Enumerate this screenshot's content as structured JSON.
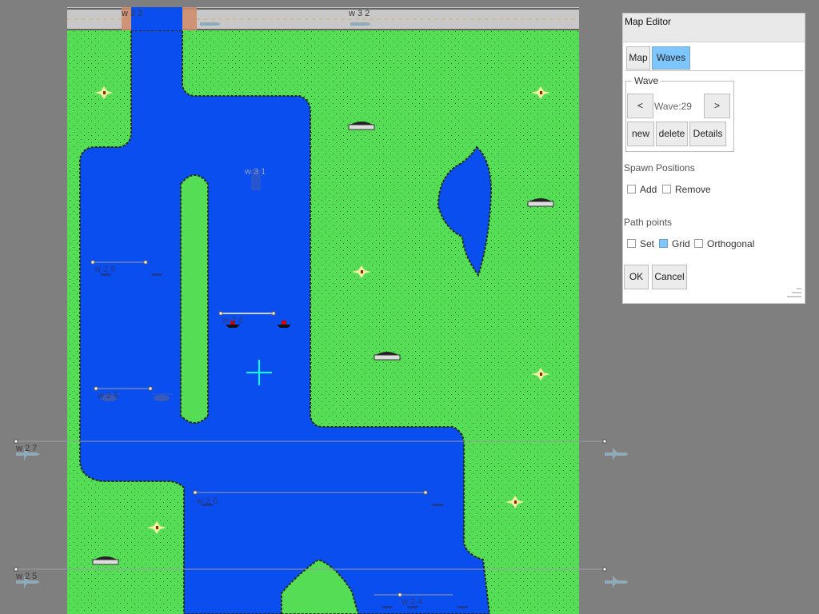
{
  "editor": {
    "title": "Map Editor",
    "tabs": [
      {
        "label": "Map"
      },
      {
        "label": "Waves"
      }
    ],
    "active_tab": "Waves",
    "wave_group": {
      "title": "Wave",
      "prev_label": "<",
      "next_label": ">",
      "wave_value": "Wave:29",
      "new_label": "new",
      "delete_label": "delete",
      "details_label": "Details"
    },
    "spawn": {
      "title": "Spawn Positions",
      "add_label": "Add",
      "add_checked": false,
      "remove_label": "Remove",
      "remove_checked": false
    },
    "path": {
      "title": "Path points",
      "set_label": "Set",
      "set_checked": false,
      "grid_label": "Grid",
      "grid_checked": true,
      "orthogonal_label": "Orthogonal",
      "orthogonal_checked": false
    },
    "ok_label": "OK",
    "cancel_label": "Cancel"
  },
  "map": {
    "colors": {
      "background": "#7f7f7f",
      "land": "#55dd55",
      "water": "#0a4ef0",
      "road": "#c8c8c8",
      "highlight": "#7ec6ff",
      "cursor": "#00ffff"
    },
    "wave_labels": {
      "road_left": "w 3 3",
      "road_right": "w 3 2",
      "upper_bridge": "w 3 1",
      "left_boats": "w 2 9",
      "center_boats": "w 2 8",
      "left_heli": "w 2 6",
      "plane_line_1": "w 2 7",
      "lower_boats": "w 2 6",
      "plane_line_2": "w 2 5",
      "bottom_boats": "w 2 4"
    }
  }
}
